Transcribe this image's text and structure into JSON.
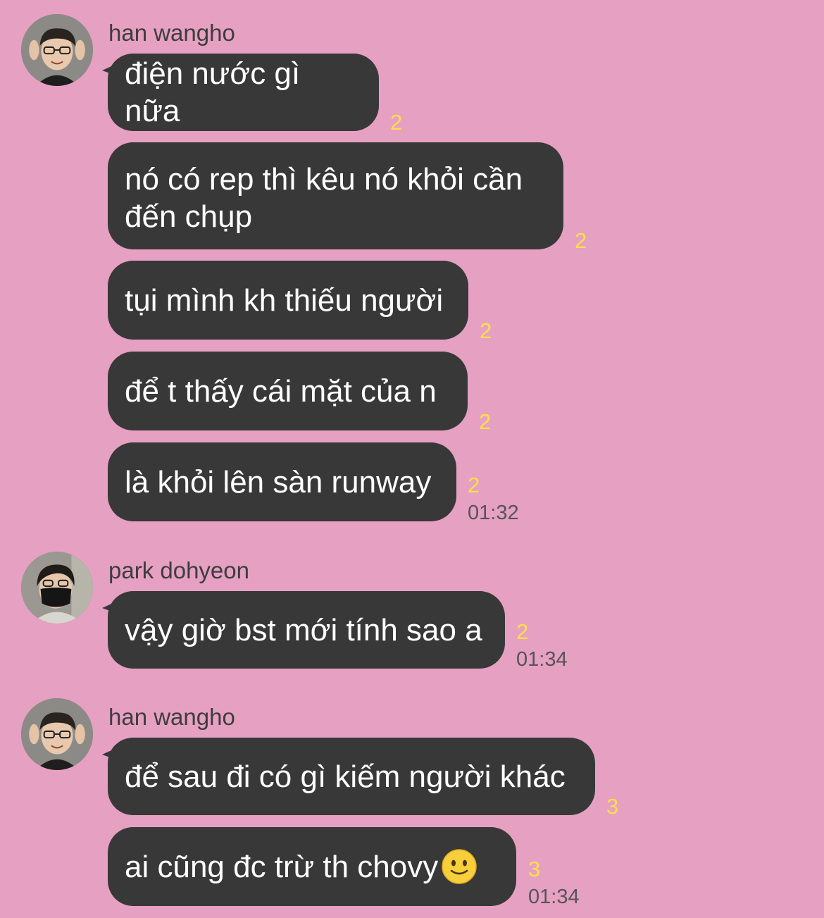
{
  "theme": {
    "background": "#e6a0c2",
    "bubble": "#383838",
    "read_count_color": "#fbe046"
  },
  "groups": [
    {
      "sender": "han wangho",
      "avatar_icon": "avatar-han-wangho",
      "messages": [
        {
          "text": "điện nước gì nữa",
          "read": "2"
        },
        {
          "text": "nó có rep thì kêu nó khỏi cần\nđến chụp",
          "read": "2"
        },
        {
          "text": "tụi mình kh thiếu người",
          "read": "2"
        },
        {
          "text": "để t thấy cái mặt của n",
          "read": "2"
        },
        {
          "text": "là khỏi lên sàn runway",
          "read": "2",
          "time": "01:32"
        }
      ]
    },
    {
      "sender": "park dohyeon",
      "avatar_icon": "avatar-park-dohyeon",
      "messages": [
        {
          "text": "vậy giờ bst mới tính sao a",
          "read": "2",
          "time": "01:34"
        }
      ]
    },
    {
      "sender": "han wangho",
      "avatar_icon": "avatar-han-wangho",
      "messages": [
        {
          "text": "để sau đi có gì kiếm người khác",
          "read": "3"
        },
        {
          "text": "ai cũng đc trừ th chovy",
          "emoji": "slightly-smiling-face-icon",
          "read": "3",
          "time": "01:34"
        }
      ]
    }
  ]
}
